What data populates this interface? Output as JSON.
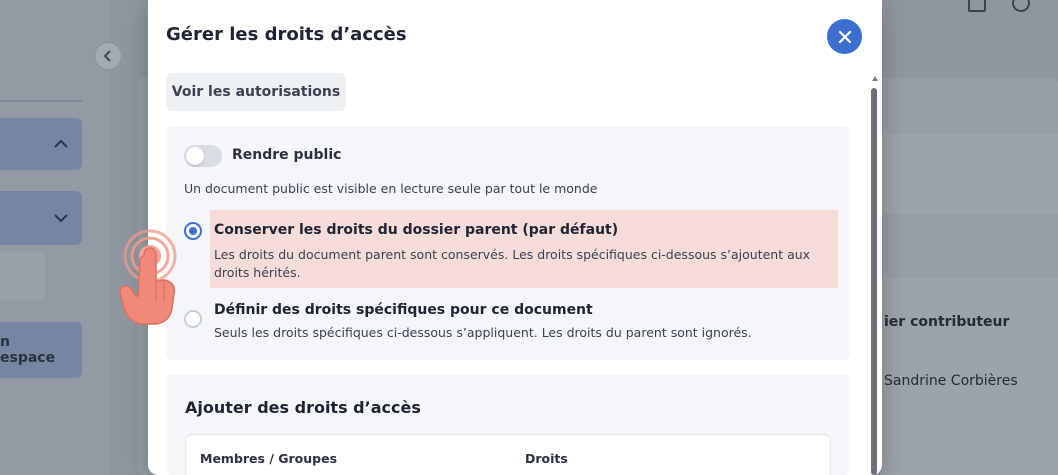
{
  "background": {
    "nav_space_label": "n espace",
    "right_heading": "ier contributeur",
    "right_person": "Sandrine Corbières"
  },
  "modal": {
    "title": "Gérer les droits d’accès",
    "close_icon": "close-icon",
    "view_permissions_label": "Voir les autorisations",
    "public_toggle": {
      "label": "Rendre public",
      "description": "Un document public est visible en lecture seule par tout le monde",
      "on": false
    },
    "options": [
      {
        "title": "Conserver les droits du dossier parent (par défaut)",
        "description": "Les droits du document parent sont conservés. Les droits spécifiques ci-dessous s’ajoutent aux droits hérités.",
        "selected": true
      },
      {
        "title": "Définir des droits spécifiques pour ce document",
        "description": "Seuls les droits spécifiques ci-dessous s’appliquent. Les droits du parent sont ignorés.",
        "selected": false
      }
    ],
    "add_rights": {
      "title": "Ajouter des droits d’accès",
      "columns": [
        "Membres / Groupes",
        "Droits"
      ]
    }
  },
  "colors": {
    "accent": "#3b6fd0",
    "highlight": "#f5dcd9",
    "tap_hint": "#f08a78"
  }
}
